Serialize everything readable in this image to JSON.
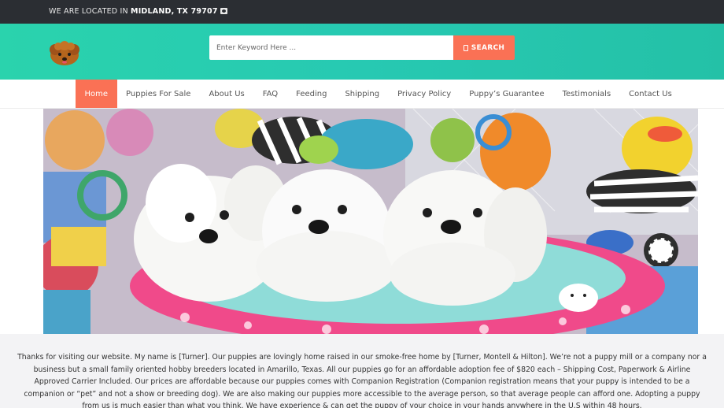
{
  "topbar": {
    "location_prefix": "WE ARE LOCATED IN ",
    "location_city": "MIDLAND, TX 79707",
    "icon": "map-marker-icon"
  },
  "header": {
    "logo_icon": "puppy-logo",
    "search": {
      "placeholder": "Enter Keyword Here ...",
      "value": "",
      "button_label": "SEARCH",
      "button_icon": "document-icon"
    },
    "colors": {
      "header_bg": "#2ad3ad",
      "accent": "#fa7155",
      "topbar_bg": "#2b2e33"
    }
  },
  "nav": {
    "items": [
      {
        "label": "Home",
        "active": true
      },
      {
        "label": "Puppies For Sale"
      },
      {
        "label": "About Us"
      },
      {
        "label": "FAQ"
      },
      {
        "label": "Feeding"
      },
      {
        "label": "Shipping"
      },
      {
        "label": "Privacy Policy"
      },
      {
        "label": "Puppy’s Guarantee"
      },
      {
        "label": "Testimonials"
      },
      {
        "label": "Contact Us"
      }
    ]
  },
  "hero": {
    "image": "three-white-maltese-puppies-photo"
  },
  "about": {
    "text": "Thanks for visiting our website. My name is [Turner]. Our puppies are lovingly home raised in our smoke-free home by [Turner, Montell & Hilton]. We’re not a puppy mill or a company nor a business but a small family oriented hobby breeders located in Amarillo, Texas. All our puppies go for an affordable adoption fee of $820 each – Shipping Cost, Paperwork & Airline Approved Carrier Included. Our prices are affordable because our puppies comes with Companion Registration (Companion registration means that your puppy is intended to be a companion or “pet” and not a show or breeding dog). We are also making our puppies more accessible to the average person, so that average people can afford one. Adopting a puppy from us is much easier than what you think. We have experience & can get the puppy of your choice in your hands anywhere in the U.S within 48 hours."
  }
}
